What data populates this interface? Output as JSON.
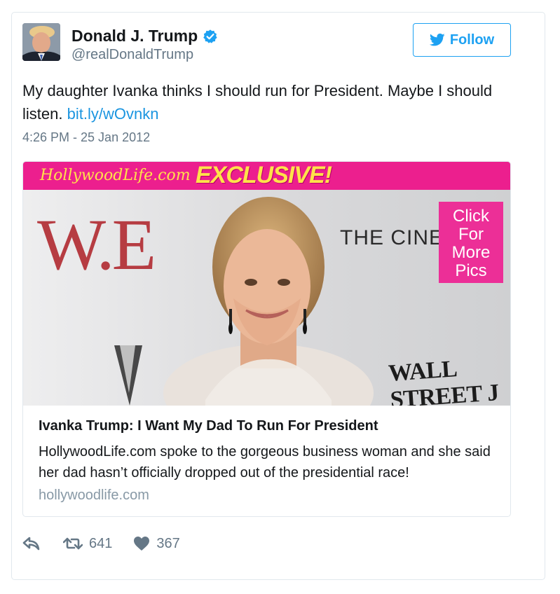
{
  "author": {
    "name": "Donald J. Trump",
    "handle": "@realDonaldTrump",
    "verified": true
  },
  "follow_button": {
    "label": "Follow",
    "icon": "twitter-bird-icon"
  },
  "tweet": {
    "text": "My daughter Ivanka thinks I should run for President. Maybe I should listen.",
    "link": "bit.ly/wOvnkn",
    "timestamp": "4:26 PM - 25 Jan 2012"
  },
  "card": {
    "image": {
      "brand": "HollywoodLife.com",
      "exclusive": "EXCLUSIVE!",
      "backdrop_left": "W.E",
      "backdrop_right": "THE CINE",
      "backdrop_bottom": "WALL STREET J",
      "cta_lines": [
        "Click",
        "For",
        "More",
        "Pics"
      ]
    },
    "title": "Ivanka Trump: I Want My Dad To Run For President",
    "description": "HollywoodLife.com spoke to the gorgeous business woman and she said her dad hasn’t officially dropped out of the presidential race!",
    "domain": "hollywoodlife.com"
  },
  "actions": {
    "reply_icon": "reply-icon",
    "retweet_icon": "retweet-icon",
    "retweet_count": "641",
    "like_icon": "heart-icon",
    "like_count": "367"
  },
  "colors": {
    "twitter_blue": "#1da1f2",
    "link": "#1b95e0",
    "muted": "#657786",
    "banner_pink": "#ec1f8e",
    "banner_yellow": "#ffe24a"
  }
}
